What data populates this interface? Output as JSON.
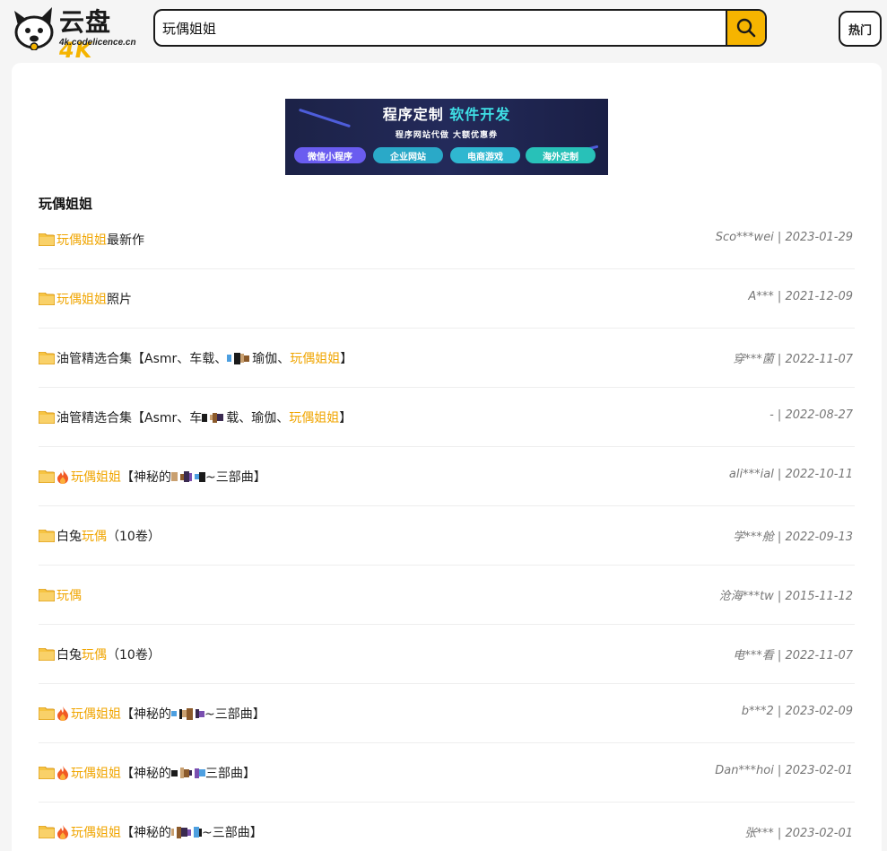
{
  "header": {
    "logo_title": "云盘",
    "logo_badge": "4K",
    "logo_sub": "4k.codelicence.cn",
    "search_value": "玩偶姐姐",
    "hot_label": "热门"
  },
  "banner": {
    "title_a": "程序定制",
    "title_b": "软件开发",
    "subtitle": "程序网站代做 大额优惠券",
    "tags": [
      "微信小程序",
      "企业网站",
      "电商游戏",
      "海外定制"
    ],
    "colors": [
      "#6a5cf0",
      "#2aa9c8",
      "#2fb7d0",
      "#28c1b8"
    ]
  },
  "section_title": "玩偶姐姐",
  "accent_color": "#f0a500",
  "results": [
    {
      "hl": "玩偶姐姐",
      "suffix": " 最新作",
      "meta": "Sco***wei | 2023-01-29",
      "fire": false,
      "pix": false
    },
    {
      "hl": "玩偶姐姐",
      "suffix": "照片",
      "meta": "A*** | 2021-12-09",
      "fire": false,
      "pix": false
    },
    {
      "prefix": "油管精选合集【Asmr、车载、",
      "pixtext": "瑜",
      "mid": "伽、",
      "hl": "玩偶姐姐",
      "suffix": "】",
      "meta": "穿***菌 | 2022-11-07",
      "fire": false,
      "pix": true
    },
    {
      "prefix": "油管精选合集【Asmr、车",
      "pixtext": "载、瑜",
      "mid": "伽、",
      "hl": "玩偶姐姐",
      "suffix": "】",
      "meta": "- | 2022-08-27",
      "fire": false,
      "pix": true
    },
    {
      "hl": "玩偶姐姐",
      "suffix_pre": "【神秘的",
      "pixtext": "",
      "suffix": "~三部曲】",
      "meta": "ali***ial | 2022-10-11",
      "fire": true,
      "pix": true
    },
    {
      "prefix": "白兔",
      "hl": "玩偶",
      "suffix": "（10卷）",
      "meta": "学***舱 | 2022-09-13",
      "fire": false,
      "pix": false
    },
    {
      "hl": "玩偶",
      "suffix": "",
      "meta": "沧海***tw | 2015-11-12",
      "fire": false,
      "pix": false
    },
    {
      "prefix": "白兔",
      "hl": "玩偶",
      "suffix": "（10卷）",
      "meta": "电***看 | 2022-11-07",
      "fire": false,
      "pix": false
    },
    {
      "hl": "玩偶姐姐",
      "suffix_pre": "【神秘的",
      "pixtext": "",
      "suffix": "~三部曲】",
      "meta": "b***2 | 2023-02-09",
      "fire": true,
      "pix": true
    },
    {
      "hl": "玩偶姐姐",
      "suffix_pre": "【神秘的",
      "pixtext": "",
      "suffix": "三部曲】",
      "meta": "Dan***hoi | 2023-02-01",
      "fire": true,
      "pix": true
    },
    {
      "hl": "玩偶姐姐",
      "suffix_pre": "【神秘的",
      "pixtext": "",
      "suffix": "~三部曲】",
      "meta": "张*** | 2023-02-01",
      "fire": true,
      "pix": true
    }
  ]
}
